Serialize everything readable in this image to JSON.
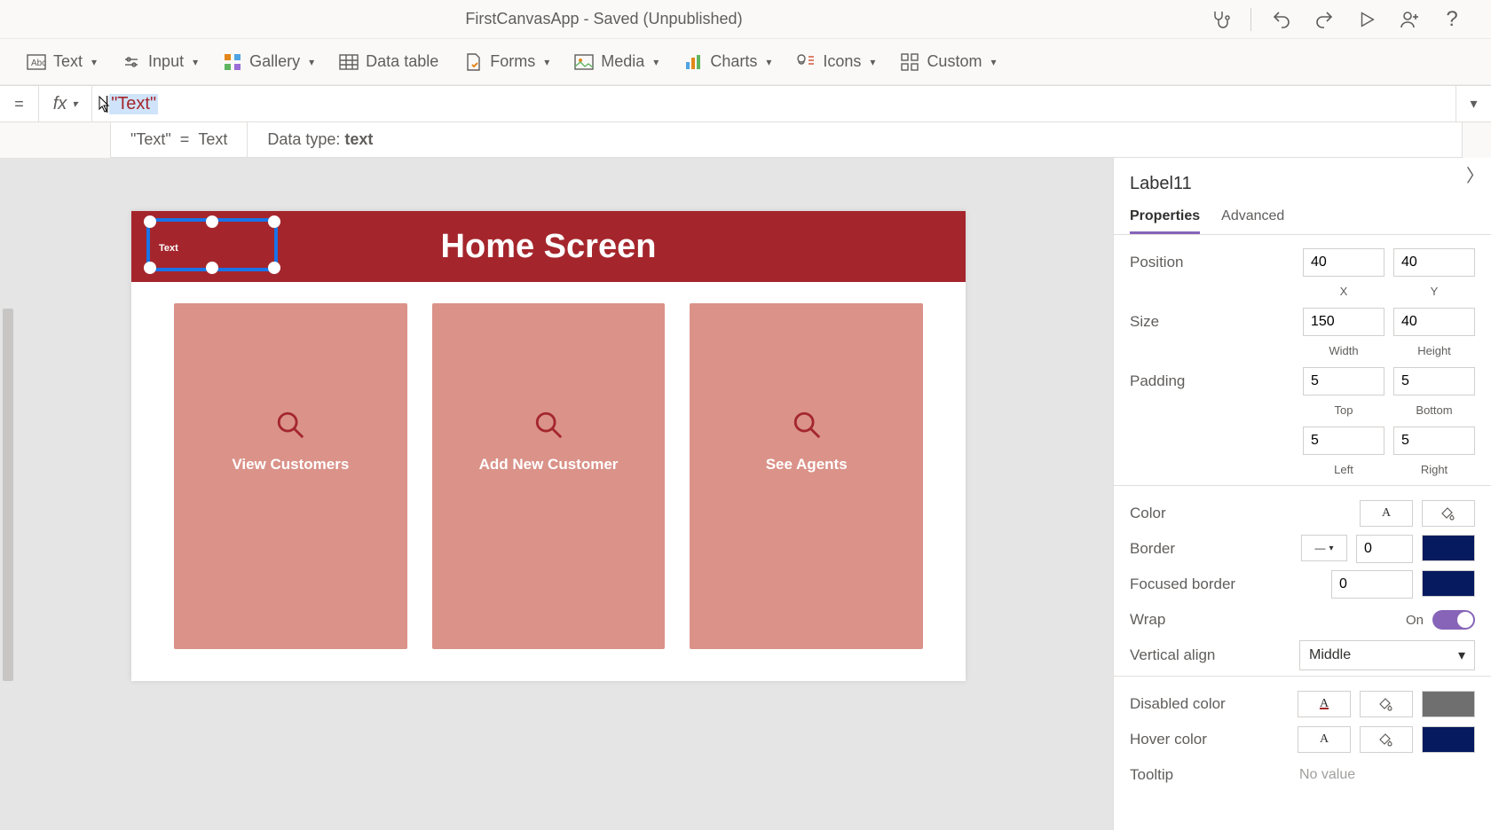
{
  "titlebar": {
    "title": "FirstCanvasApp - Saved (Unpublished)"
  },
  "ribbon": {
    "text": "Text",
    "input": "Input",
    "gallery": "Gallery",
    "datatable": "Data table",
    "forms": "Forms",
    "media": "Media",
    "charts": "Charts",
    "icons": "Icons",
    "custom": "Custom"
  },
  "formula": {
    "fx_label": "fx",
    "value": "\"Text\"",
    "result_lhs": "\"Text\"",
    "result_eq": "=",
    "result_rhs": "Text",
    "datatype_label": "Data type: ",
    "datatype_value": "text"
  },
  "canvas": {
    "header_title": "Home Screen",
    "selected_label_text": "Text",
    "card1": "View Customers",
    "card2": "Add New Customer",
    "card3": "See Agents"
  },
  "props": {
    "control_name": "Label11",
    "tab_properties": "Properties",
    "tab_advanced": "Advanced",
    "position_label": "Position",
    "pos_x": "40",
    "pos_y": "40",
    "x_label": "X",
    "y_label": "Y",
    "size_label": "Size",
    "width": "150",
    "height": "40",
    "w_label": "Width",
    "h_label": "Height",
    "padding_label": "Padding",
    "pad_top": "5",
    "pad_bottom": "5",
    "pad_left": "5",
    "pad_right": "5",
    "top_label": "Top",
    "bottom_label": "Bottom",
    "left_label": "Left",
    "right_label": "Right",
    "color_label": "Color",
    "border_label": "Border",
    "border_width": "0",
    "border_color": "#061a60",
    "focused_label": "Focused border",
    "focused_width": "0",
    "focused_color": "#061a60",
    "wrap_label": "Wrap",
    "wrap_on": "On",
    "valign_label": "Vertical align",
    "valign_value": "Middle",
    "disabled_label": "Disabled color",
    "disabled_box": "#6f6f6f",
    "hover_label": "Hover color",
    "hover_box": "#061a60",
    "tooltip_label": "Tooltip",
    "tooltip_value": "No value"
  }
}
